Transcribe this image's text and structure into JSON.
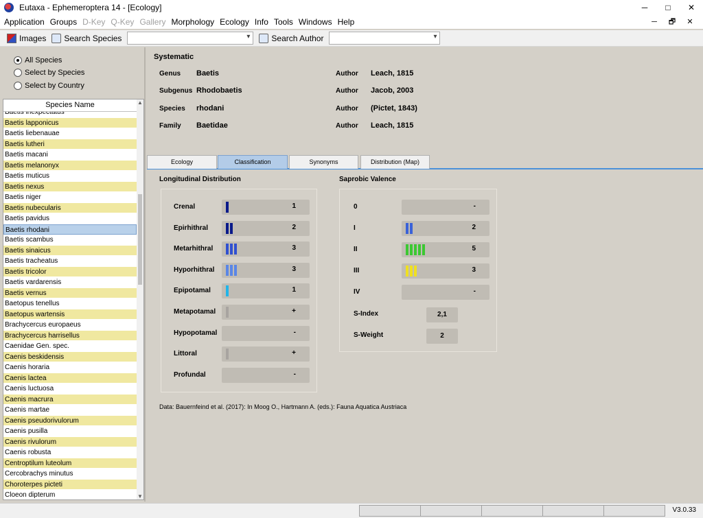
{
  "window": {
    "title": "Eutaxa - Ephemeroptera 14 - [Ecology]",
    "minimize": "─",
    "maximize": "□",
    "close": "✕"
  },
  "menu": [
    "Application",
    "Groups",
    "D-Key",
    "Q-Key",
    "Gallery",
    "Morphology",
    "Ecology",
    "Info",
    "Tools",
    "Windows",
    "Help"
  ],
  "menu_disabled": [
    "D-Key",
    "Q-Key",
    "Gallery"
  ],
  "mdi": {
    "minimize": "─",
    "restore": "🗗",
    "close": "✕"
  },
  "toolbar": {
    "images_label": "Images",
    "search_species_label": "Search Species",
    "search_species_value": "",
    "search_author_label": "Search Author",
    "search_author_value": ""
  },
  "filter": {
    "options": [
      "All Species",
      "Select by Species",
      "Select by Country"
    ],
    "selected": "All Species"
  },
  "species_list": {
    "header": "Species Name",
    "selected": "Baetis rhodani",
    "rows": [
      {
        "name": "Baetis inexpectatus",
        "hl": false
      },
      {
        "name": "Baetis lapponicus",
        "hl": true
      },
      {
        "name": "Baetis liebenauae",
        "hl": false
      },
      {
        "name": "Baetis lutheri",
        "hl": true
      },
      {
        "name": "Baetis macani",
        "hl": false
      },
      {
        "name": "Baetis melanonyx",
        "hl": true
      },
      {
        "name": "Baetis muticus",
        "hl": false
      },
      {
        "name": "Baetis nexus",
        "hl": true
      },
      {
        "name": "Baetis niger",
        "hl": false
      },
      {
        "name": "Baetis nubecularis",
        "hl": true
      },
      {
        "name": "Baetis pavidus",
        "hl": false
      },
      {
        "name": "Baetis rhodani",
        "hl": false
      },
      {
        "name": "Baetis scambus",
        "hl": false
      },
      {
        "name": "Baetis sinaicus",
        "hl": true
      },
      {
        "name": "Baetis tracheatus",
        "hl": false
      },
      {
        "name": "Baetis tricolor",
        "hl": true
      },
      {
        "name": "Baetis vardarensis",
        "hl": false
      },
      {
        "name": "Baetis vernus",
        "hl": true
      },
      {
        "name": "Baetopus tenellus",
        "hl": false
      },
      {
        "name": "Baetopus wartensis",
        "hl": true
      },
      {
        "name": "Brachycercus europaeus",
        "hl": false
      },
      {
        "name": "Brachycercus harrisellus",
        "hl": true
      },
      {
        "name": "Caenidae Gen. spec.",
        "hl": false
      },
      {
        "name": "Caenis beskidensis",
        "hl": true
      },
      {
        "name": "Caenis horaria",
        "hl": false
      },
      {
        "name": "Caenis lactea",
        "hl": true
      },
      {
        "name": "Caenis luctuosa",
        "hl": false
      },
      {
        "name": "Caenis macrura",
        "hl": true
      },
      {
        "name": "Caenis martae",
        "hl": false
      },
      {
        "name": "Caenis pseudorivulorum",
        "hl": true
      },
      {
        "name": "Caenis pusilla",
        "hl": false
      },
      {
        "name": "Caenis rivulorum",
        "hl": true
      },
      {
        "name": "Caenis robusta",
        "hl": false
      },
      {
        "name": "Centroptilum luteolum",
        "hl": true
      },
      {
        "name": "Cercobrachys minutus",
        "hl": false
      },
      {
        "name": "Choroterpes picteti",
        "hl": true
      },
      {
        "name": "Cloeon dipterum",
        "hl": false
      }
    ]
  },
  "systematic": {
    "title": "Systematic",
    "rows": [
      {
        "label": "Genus",
        "value": "Baetis",
        "author_label": "Author",
        "author": "Leach, 1815"
      },
      {
        "label": "Subgenus",
        "value": "Rhodobaetis",
        "author_label": "Author",
        "author": "Jacob, 2003"
      },
      {
        "label": "Species",
        "value": "rhodani",
        "author_label": "Author",
        "author": "(Pictet, 1843)"
      },
      {
        "label": "Family",
        "value": "Baetidae",
        "author_label": "Author",
        "author": "Leach, 1815"
      }
    ]
  },
  "tabs": [
    "Ecology",
    "Classification",
    "Synonyms",
    "Distribution (Map)"
  ],
  "active_tab": "Classification",
  "longitudinal": {
    "title": "Longitudinal Distribution",
    "rows": [
      {
        "label": "Crenal",
        "value": "1",
        "level": 1,
        "color": "#0a1a8a"
      },
      {
        "label": "Epirhithral",
        "value": "2",
        "level": 2,
        "color": "#0a1a8a"
      },
      {
        "label": "Metarhithral",
        "value": "3",
        "level": 3,
        "color": "#3050d0"
      },
      {
        "label": "Hyporhithral",
        "value": "3",
        "level": 3,
        "color": "#5a86e6"
      },
      {
        "label": "Epipotamal",
        "value": "1",
        "level": 1,
        "color": "#22b4e8"
      },
      {
        "label": "Metapotamal",
        "value": "+",
        "level": 1,
        "color": "#a8a4a0"
      },
      {
        "label": "Hypopotamal",
        "value": "-",
        "level": 0,
        "color": "#a8a4a0"
      },
      {
        "label": "Littoral",
        "value": "+",
        "level": 1,
        "color": "#a8a4a0"
      },
      {
        "label": "Profundal",
        "value": "-",
        "level": 0,
        "color": "#a8a4a0"
      }
    ]
  },
  "saprobic": {
    "title": "Saprobic Valence",
    "rows": [
      {
        "label": "0",
        "value": "-",
        "level": 0,
        "color": "#a8a4a0"
      },
      {
        "label": "I",
        "value": "2",
        "level": 2,
        "color": "#3a62d8"
      },
      {
        "label": "II",
        "value": "5",
        "level": 5,
        "color": "#3cc832"
      },
      {
        "label": "III",
        "value": "3",
        "level": 3,
        "color": "#f0e020"
      },
      {
        "label": "IV",
        "value": "-",
        "level": 0,
        "color": "#a8a4a0"
      }
    ],
    "s_index_label": "S-Index",
    "s_index": "2,1",
    "s_weight_label": "S-Weight",
    "s_weight": "2"
  },
  "data_note": "Data: Bauernfeind et al. (2017): In Moog O., Hartmann A. (eds.): Fauna Aquatica Austriaca",
  "status": {
    "version": "V3.0.33"
  }
}
